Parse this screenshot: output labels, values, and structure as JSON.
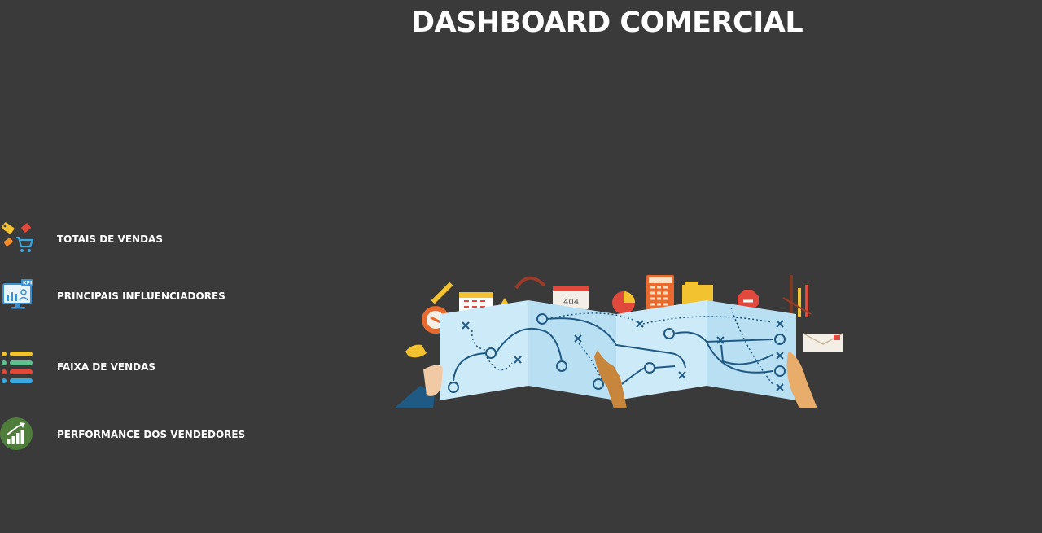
{
  "header": {
    "title": "DASHBOARD COMERCIAL"
  },
  "nav": {
    "items": [
      {
        "label": "TOTAIS DE VENDAS",
        "icon": "price-tags-cart-icon"
      },
      {
        "label": "PRINCIPAIS INFLUENCIADORES",
        "icon": "kpi-monitor-icon"
      },
      {
        "label": "FAIXA DE VENDAS",
        "icon": "colored-list-icon"
      },
      {
        "label": "PERFORMANCE DOS VENDEDORES",
        "icon": "growth-chart-icon"
      }
    ]
  },
  "hero": {
    "icon": "strategy-map-illustration",
    "sticker_text": "404"
  },
  "colors": {
    "background": "#3a3a3a",
    "text": "#ffffff",
    "map_light": "#cdeaf8",
    "map_line": "#1f5a85",
    "accent_yellow": "#f2c230",
    "accent_red": "#e0493c"
  }
}
